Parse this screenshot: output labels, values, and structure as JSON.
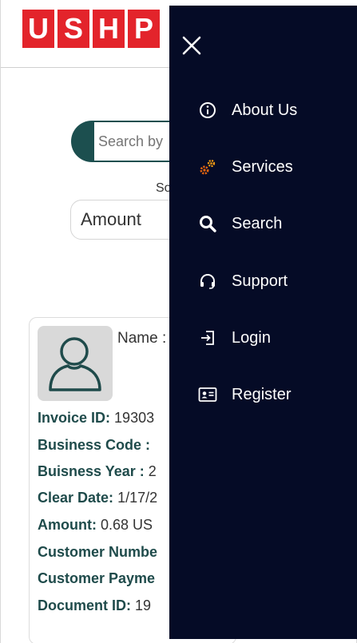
{
  "header": {
    "logo_letters": [
      "U",
      "S",
      "H",
      "P"
    ],
    "brand_color": "#e3242b"
  },
  "search": {
    "placeholder": "Search by",
    "accent": "#1c4f4f"
  },
  "sort": {
    "label": "So",
    "selected": "Amount"
  },
  "card": {
    "name_label": "Name :",
    "fields": [
      {
        "label": "Invoice ID:",
        "value": "19303"
      },
      {
        "label": "Business Code :",
        "value": ""
      },
      {
        "label": "Buisness Year :",
        "value": "2"
      },
      {
        "label": "Clear Date:",
        "value": "1/17/2"
      },
      {
        "label": "Amount:",
        "value": "0.68 US"
      },
      {
        "label": "Customer Numbe",
        "value": ""
      },
      {
        "label": "Customer Payme",
        "value": ""
      },
      {
        "label": "Document ID:",
        "value": "19"
      }
    ]
  },
  "menu": {
    "background": "#050b26",
    "close_icon": "close-icon",
    "items": [
      {
        "label": "About Us",
        "icon": "info-icon"
      },
      {
        "label": "Services",
        "icon": "gears-icon"
      },
      {
        "label": "Search",
        "icon": "search-icon"
      },
      {
        "label": "Support",
        "icon": "headset-icon"
      },
      {
        "label": "Login",
        "icon": "login-icon"
      },
      {
        "label": "Register",
        "icon": "id-card-icon"
      }
    ]
  }
}
